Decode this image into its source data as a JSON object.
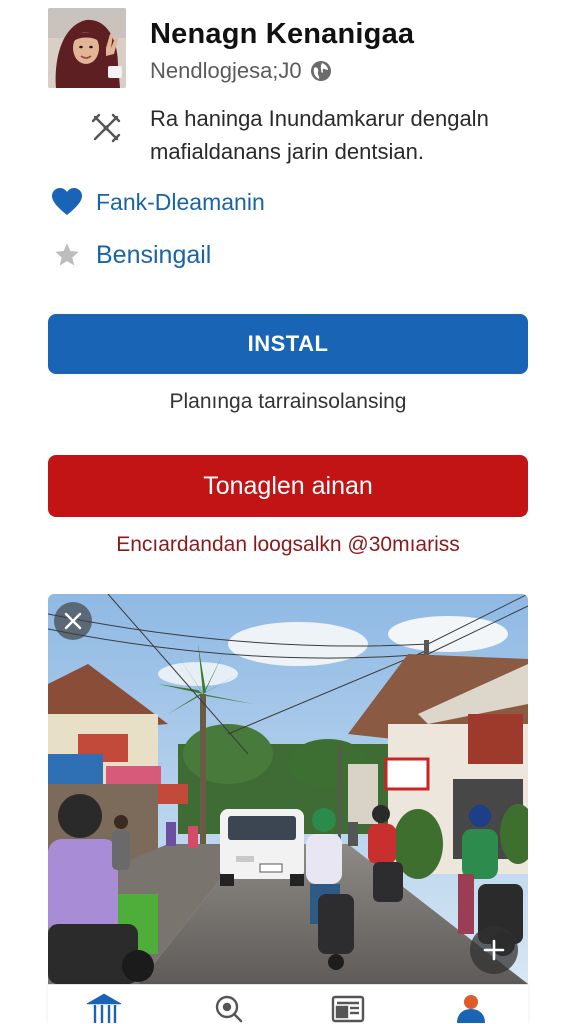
{
  "app": {
    "name": "Nenagn Kenanigaa",
    "subtitle": "Nendlogjesa;J0",
    "description_line1": "Ra haninga Inundamkarur dengaln",
    "description_line2": "mafialdanans jarin dentsian."
  },
  "links": {
    "favorite_label": "Fank-Dleamanin",
    "rating_label": "Bensingail"
  },
  "install": {
    "button_label": "INSTAL",
    "caption": "Planınga tarrainsolansing"
  },
  "action": {
    "button_label": "Tonaglen ainan",
    "caption": "Encıardandan loogsalkn @30mıariss"
  },
  "icons": {
    "globe": "globe-icon",
    "tools": "tools-icon",
    "favorite": "heart-icon",
    "rating": "star-icon",
    "close": "close-icon",
    "add": "plus-icon",
    "nav": [
      "home-icon",
      "search-icon",
      "news-icon",
      "profile-icon"
    ]
  },
  "colors": {
    "install_button": "#1a64b5",
    "action_button": "#c31415",
    "link_text": "#1765a8",
    "caption_red": "#8b1a1a"
  }
}
